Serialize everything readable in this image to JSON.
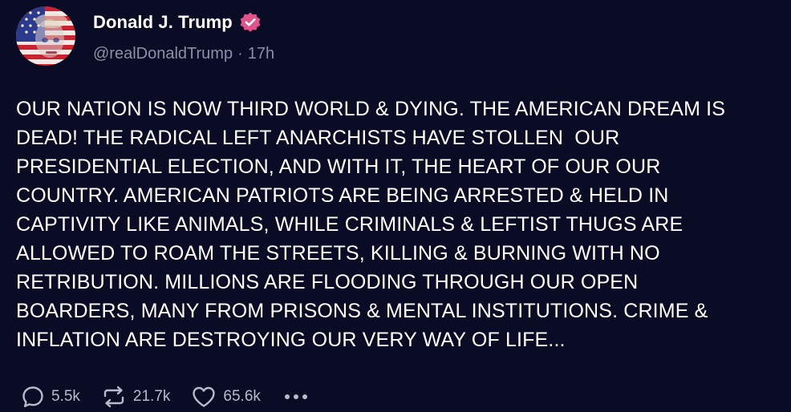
{
  "post": {
    "author": {
      "display_name": "Donald J. Trump",
      "handle": "@realDonaldTrump",
      "separator": "·",
      "time": "17h",
      "verified_icon": "verified-badge-icon",
      "avatar_icon": "flag-portrait-avatar"
    },
    "body_lines": [
      "OUR NATION IS NOW THIRD WORLD & DYING. THE AMERICAN DREAM IS",
      "DEAD! THE RADICAL LEFT ANARCHISTS HAVE STOLLEN  OUR",
      "PRESIDENTIAL ELECTION, AND WITH IT, THE HEART OF OUR OUR",
      "COUNTRY. AMERICAN PATRIOTS ARE BEING ARRESTED & HELD IN",
      "CAPTIVITY LIKE ANIMALS, WHILE CRIMINALS & LEFTIST THUGS ARE",
      "ALLOWED TO ROAM THE STREETS, KILLING & BURNING WITH NO",
      "RETRIBUTION. MILLIONS ARE FLOODING THROUGH OUR OPEN",
      "BOARDERS, MANY FROM PRISONS & MENTAL INSTITUTIONS. CRIME &",
      "INFLATION ARE DESTROYING OUR VERY WAY OF LIFE..."
    ],
    "actions": {
      "replies": {
        "count": "5.5k",
        "icon": "reply-icon"
      },
      "reposts": {
        "count": "21.7k",
        "icon": "repost-icon"
      },
      "likes": {
        "count": "65.6k",
        "icon": "heart-icon"
      },
      "more_icon": "more-options-icon"
    }
  },
  "colors": {
    "background": "#0a0b24",
    "text": "#ffffff",
    "muted": "#8e8fa5",
    "action": "#b9bacb",
    "verified": "#e0548a"
  }
}
